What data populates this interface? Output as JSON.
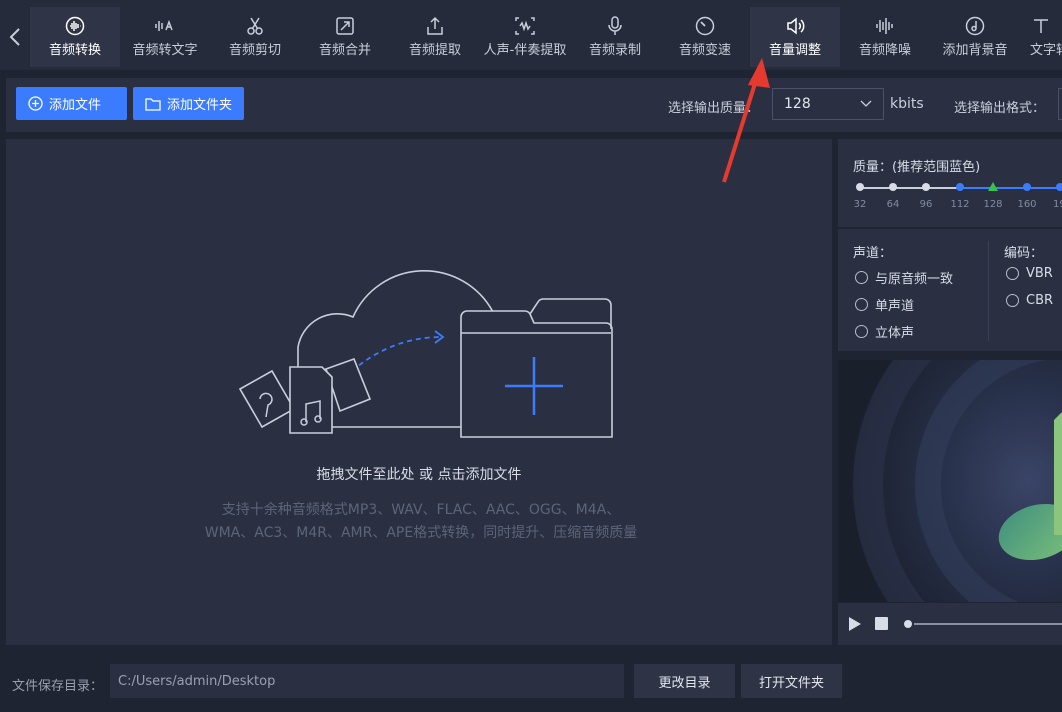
{
  "nav": {
    "tabs": [
      {
        "label": "音频转换",
        "icon": "waveform-circle-icon",
        "active": true
      },
      {
        "label": "音频转文字",
        "icon": "audio-to-text-icon",
        "active": false
      },
      {
        "label": "音频剪切",
        "icon": "scissors-icon",
        "active": false
      },
      {
        "label": "音频合并",
        "icon": "merge-icon",
        "active": false
      },
      {
        "label": "音频提取",
        "icon": "export-icon",
        "active": false
      },
      {
        "label": "人声-伴奏提取",
        "icon": "voice-separation-icon",
        "active": false
      },
      {
        "label": "音频录制",
        "icon": "microphone-icon",
        "active": false
      },
      {
        "label": "音频变速",
        "icon": "speedometer-icon",
        "active": false
      },
      {
        "label": "音量调整",
        "icon": "volume-icon",
        "active": true
      },
      {
        "label": "音频降噪",
        "icon": "equalizer-icon",
        "active": false
      },
      {
        "label": "添加背景音",
        "icon": "music-disc-icon",
        "active": false
      },
      {
        "label": "文字转",
        "icon": "text-to-audio-icon",
        "active": false
      }
    ]
  },
  "toolbar": {
    "add_file": "添加文件",
    "add_folder": "添加文件夹",
    "quality_label": "选择输出质量：",
    "quality_value": "128",
    "quality_unit": "kbits",
    "format_label": "选择输出格式："
  },
  "droparea": {
    "title": "拖拽文件至此处 或 点击添加文件",
    "desc_line1": "支持十余种音频格式MP3、WAV、FLAC、AAC、OGG、M4A、",
    "desc_line2": "WMA、AC3、M4R、AMR、APE格式转换，同时提升、压缩音频质量"
  },
  "right_panel": {
    "quality_title": "质量：(推荐范围蓝色)",
    "quality_ticks": [
      "32",
      "64",
      "96",
      "112",
      "128",
      "160",
      "19"
    ],
    "quality_selected": "128",
    "channel_title": "声道：",
    "channel_options": [
      "与原音频一致",
      "单声道",
      "立体声"
    ],
    "encoding_title": "编码：",
    "encoding_options": [
      "VBR",
      "CBR"
    ]
  },
  "bottom": {
    "save_label": "文件保存目录：",
    "save_path": "C:/Users/admin/Desktop",
    "change_dir": "更改目录",
    "open_folder": "打开文件夹"
  },
  "colors": {
    "accent": "#3b7cff",
    "arrow": "#e63a2e",
    "selected_tick": "#37c24a"
  }
}
